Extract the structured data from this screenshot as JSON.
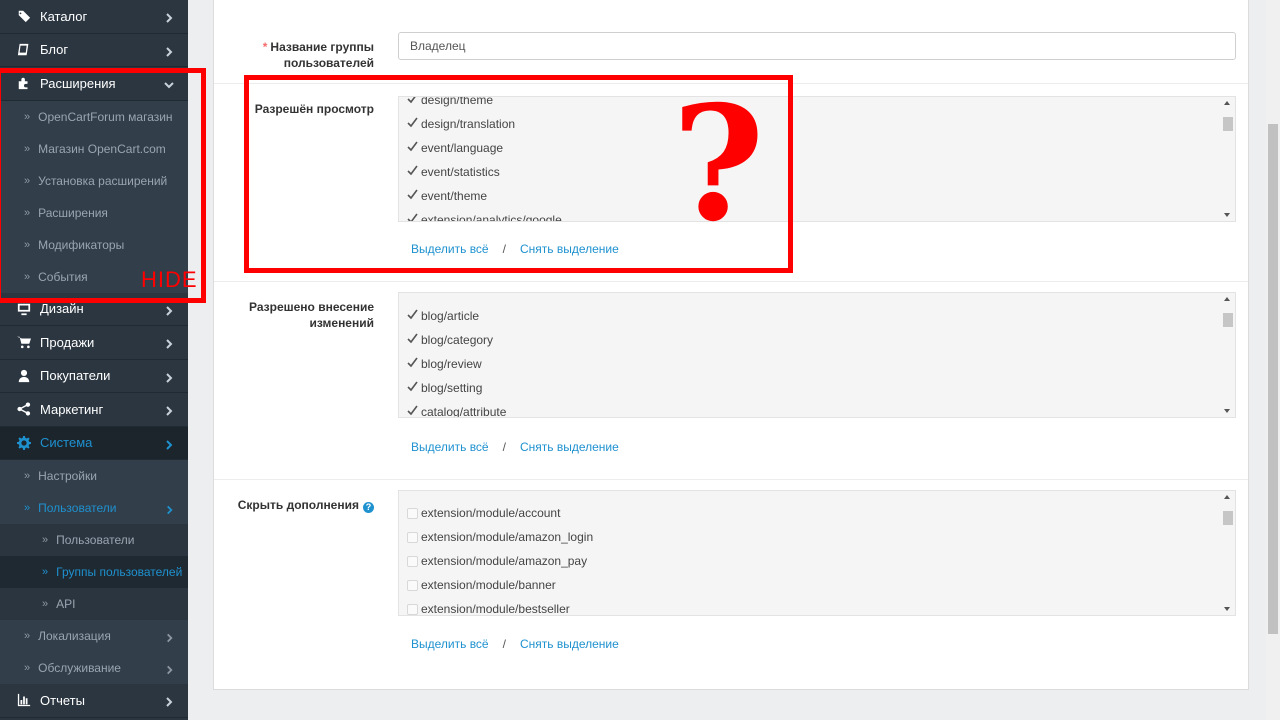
{
  "sidebar": {
    "top_items": [
      {
        "label": "Каталог",
        "icon": "tags-icon"
      },
      {
        "label": "Блог",
        "icon": "book-icon"
      },
      {
        "label": "Расширения",
        "icon": "puzzle-icon"
      }
    ],
    "extensions_sub": [
      "OpenCartForum магазин",
      "Магазин OpenCart.com",
      "Установка расширений",
      "Расширения",
      "Модификаторы",
      "События"
    ],
    "mid_items": [
      {
        "label": "Дизайн",
        "icon": "monitor-icon"
      },
      {
        "label": "Продажи",
        "icon": "cart-icon"
      },
      {
        "label": "Покупатели",
        "icon": "user-icon"
      },
      {
        "label": "Маркетинг",
        "icon": "share-icon"
      },
      {
        "label": "Система",
        "icon": "gear-icon"
      }
    ],
    "system_sub": [
      "Настройки",
      "Пользователи"
    ],
    "users_sub": [
      "Пользователи",
      "Группы пользователей",
      "API"
    ],
    "system_sub_tail": [
      "Локализация",
      "Обслуживание"
    ],
    "bottom_items": [
      {
        "label": "Отчеты",
        "icon": "bar-chart-icon"
      }
    ]
  },
  "form": {
    "group_name_label": "Название группы пользователей",
    "group_name_value": "Владелец",
    "access_label": "Разрешён просмотр",
    "access_items": [
      "design/theme",
      "design/translation",
      "event/language",
      "event/statistics",
      "event/theme",
      "extension/analytics/google"
    ],
    "modify_label": "Разрешено внесение изменений",
    "modify_items": [
      "blog/article",
      "blog/category",
      "blog/review",
      "blog/setting",
      "catalog/attribute"
    ],
    "hide_label": "Скрыть дополнения",
    "hide_items": [
      "extension/module/account",
      "extension/module/amazon_login",
      "extension/module/amazon_pay",
      "extension/module/banner",
      "extension/module/bestseller"
    ],
    "select_all": "Выделить всё",
    "separator": "/",
    "deselect": "Снять выделение"
  },
  "annotations": {
    "hide_text": "HIDE",
    "question_mark": "?",
    "color": "#ff0000"
  },
  "colors": {
    "sidebar_bg": "#2b3641",
    "accent": "#1e91cf"
  }
}
